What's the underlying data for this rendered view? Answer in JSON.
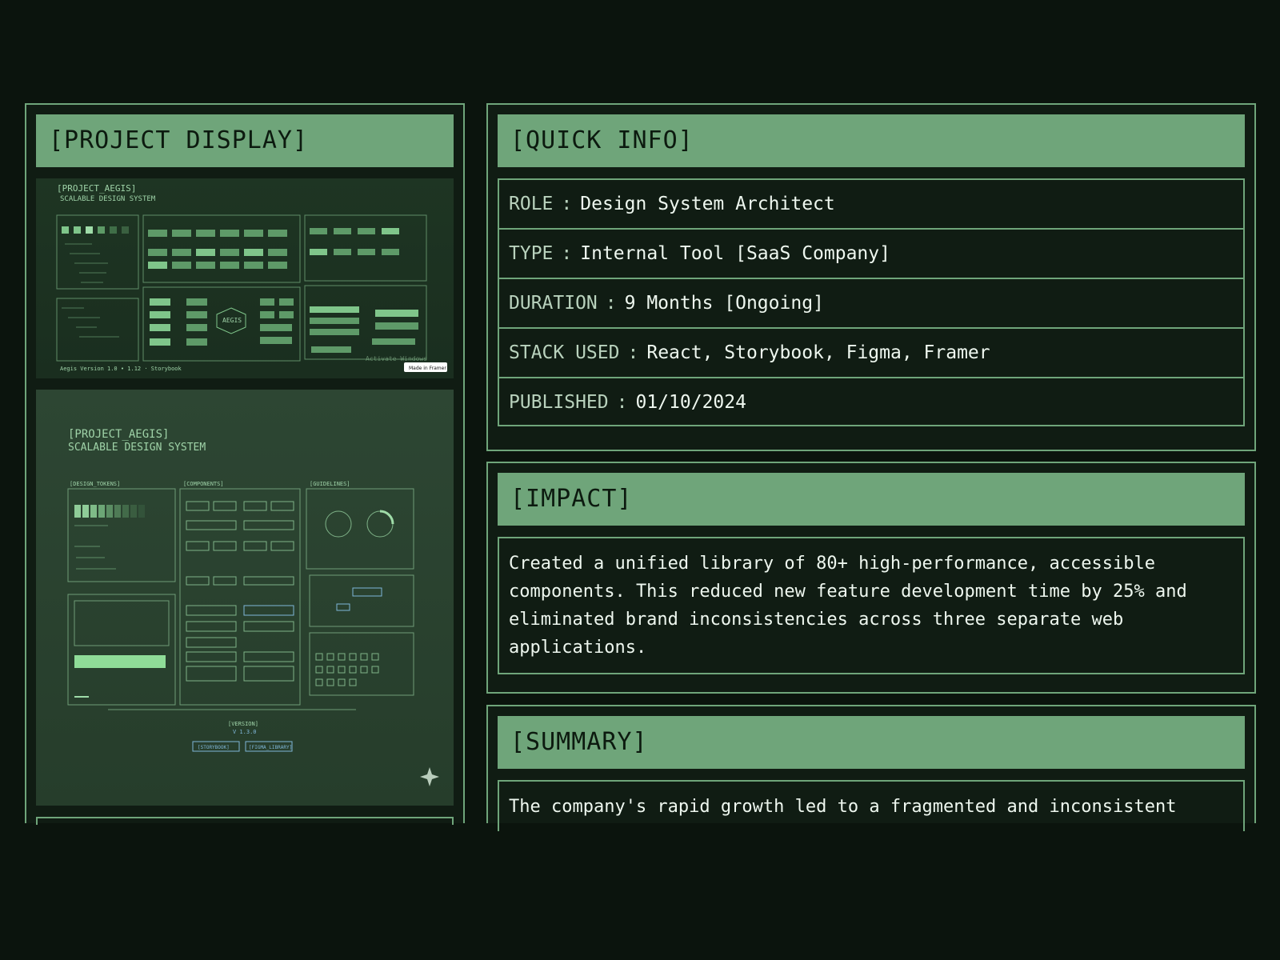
{
  "project_display": {
    "title": "[PROJECT DISPLAY]",
    "shot1": {
      "title": "[PROJECT_AEGIS]",
      "subtitle": "SCALABLE DESIGN SYSTEM",
      "center_label": "AEGIS",
      "footer": "Aegis Version 1.0 • 1.12 · Storybook",
      "watermark": "Activate Windows",
      "badge": "Made in Framer"
    },
    "shot2": {
      "title": "[PROJECT_AEGIS]",
      "subtitle": "SCALABLE DESIGN SYSTEM",
      "sections": [
        "[DESIGN_TOKENS]",
        "[COMPONENTS]",
        "[GUIDELINES]"
      ],
      "version_label": "[VERSION]",
      "version_value": "V 1.3.0",
      "links": [
        "[STORYBOOK]",
        "[FIGMA_LIBRARY]"
      ]
    }
  },
  "quick_info": {
    "title": "[QUICK INFO]",
    "rows": [
      {
        "label": "ROLE",
        "value": "Design System Architect"
      },
      {
        "label": "TYPE",
        "value": "Internal Tool [SaaS Company]"
      },
      {
        "label": "DURATION",
        "value": "9 Months [Ongoing]"
      },
      {
        "label": "STACK USED",
        "value": "React, Storybook, Figma, Framer"
      },
      {
        "label": "PUBLISHED",
        "value": "01/10/2024"
      }
    ],
    "separator": ":"
  },
  "impact": {
    "title": "[IMPACT]",
    "text": "Created a unified library of 80+ high-performance, accessible components. This reduced new feature development time by 25% and eliminated brand inconsistencies across three separate web applications."
  },
  "summary": {
    "title": "[SUMMARY]",
    "text": "The company's rapid growth led to a fragmented and inconsistent"
  }
}
